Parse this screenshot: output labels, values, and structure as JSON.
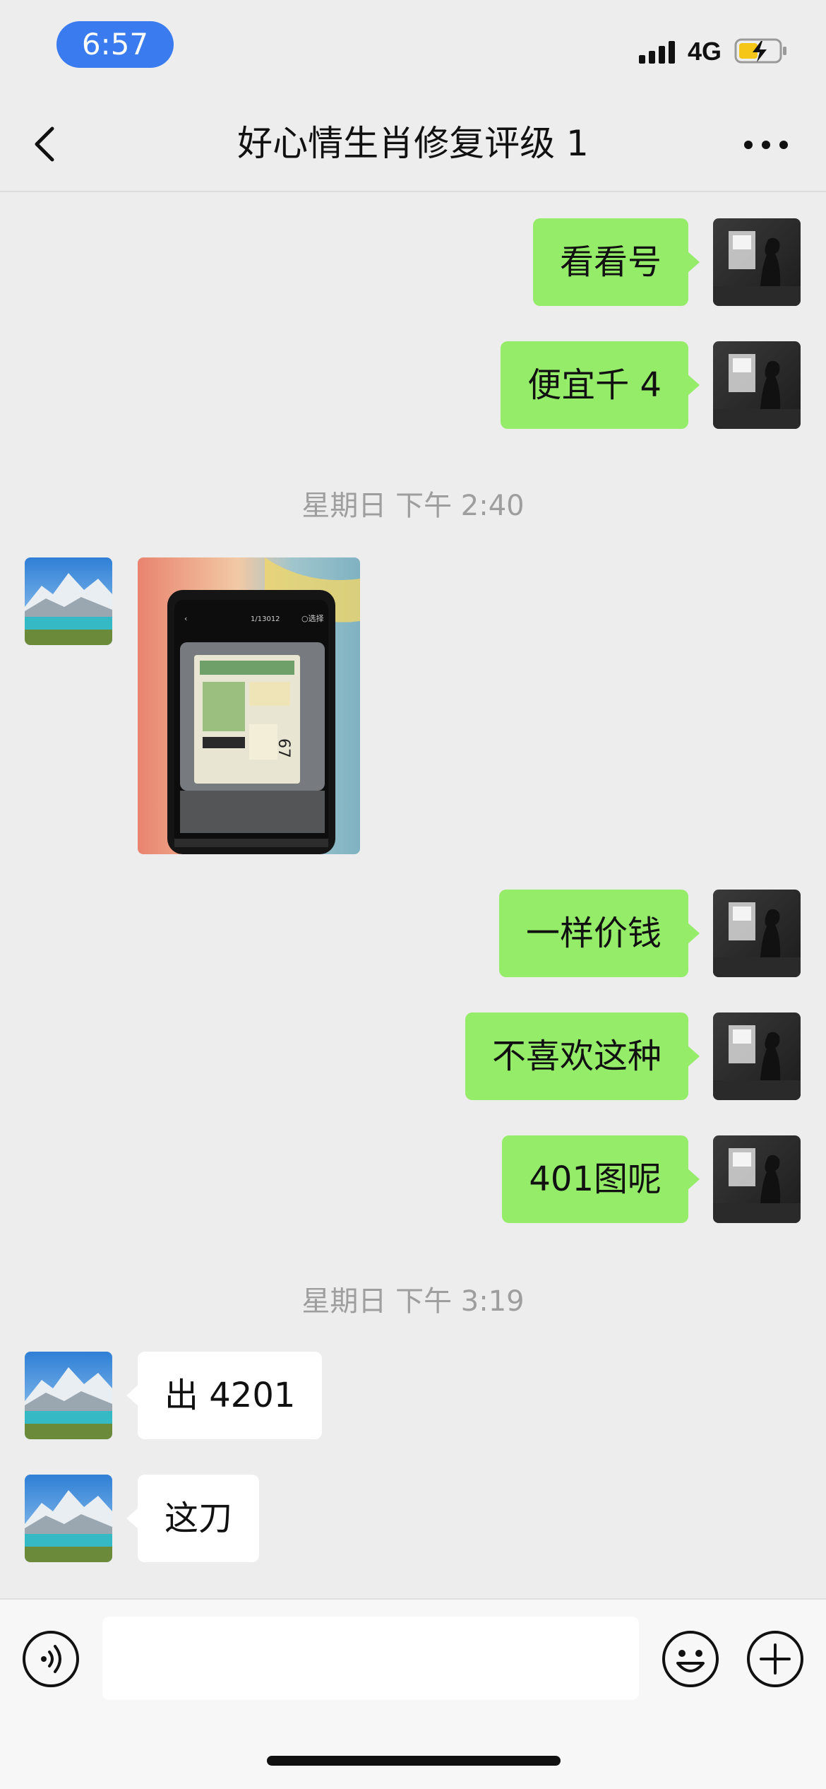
{
  "status_bar": {
    "time": "6:57",
    "network": "4G",
    "time_pill_color": "#3a7bf0"
  },
  "header": {
    "title": "好心情生肖修复评级 1",
    "back_icon": "chevron-left-icon",
    "more_icon": "more-dots-icon"
  },
  "messages": [
    {
      "sender": "me",
      "text": "看看号"
    },
    {
      "sender": "me",
      "text": "便宜千 4"
    },
    {
      "type": "timestamp",
      "text": "星期日 下午 2:40"
    },
    {
      "sender": "other",
      "type": "image"
    },
    {
      "sender": "me",
      "text": "一样价钱"
    },
    {
      "sender": "me",
      "text": "不喜欢这种"
    },
    {
      "sender": "me",
      "text": "401图呢"
    },
    {
      "type": "timestamp",
      "text": "星期日 下午 3:19"
    },
    {
      "sender": "other",
      "text": "出 4201"
    },
    {
      "sender": "other",
      "text": "这刀"
    }
  ],
  "input_bar": {
    "text_value": "",
    "voice_icon": "voice-icon",
    "emoji_icon": "emoji-icon",
    "plus_icon": "plus-icon"
  },
  "colors": {
    "my_bubble": "#95ec69",
    "their_bubble": "#ffffff",
    "background": "#ededed"
  }
}
